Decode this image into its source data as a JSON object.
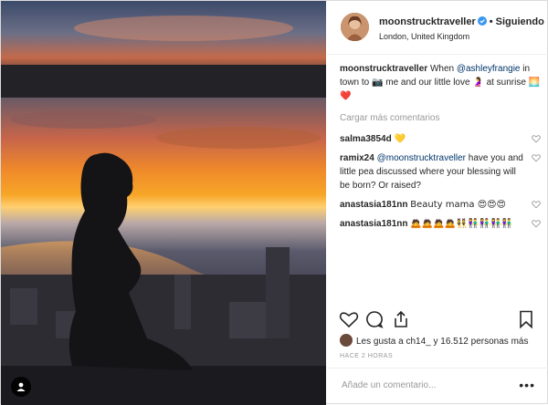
{
  "header": {
    "username": "moonstrucktraveller",
    "separator": "•",
    "follow_label": "Siguiendo",
    "location": "London, United Kingdom"
  },
  "caption": {
    "username": "moonstrucktraveller",
    "text_1": "When",
    "mention": "@ashleyfrangie",
    "text_2": "in town to",
    "emoji_1": "📷",
    "text_3": "me and our little love",
    "emoji_2": "🤰",
    "text_4": "at sunrise",
    "emoji_3": "🌅❤️"
  },
  "load_more_label": "Cargar más comentarios",
  "comments": [
    {
      "username": "salma3854d",
      "text": "💛"
    },
    {
      "username": "ramix24",
      "mention": "@moonstrucktraveller",
      "text": "have you and little pea discussed where your blessing will be born? Or raised?"
    },
    {
      "username": "anastasia181nn",
      "text": "Beauty mama 😍😍😍"
    },
    {
      "username": "anastasia181nn",
      "text": "🙇🙇🙇🙇👯👫👫👫👫"
    }
  ],
  "likes": {
    "text": "Les gusta a ch14_ y 16.512 personas más"
  },
  "timestamp": "HACE 2 HORAS",
  "add_comment": {
    "placeholder": "Añade un comentario..."
  },
  "more_options": "•••",
  "colors": {
    "border": "#dbdbdb",
    "text": "#262626",
    "muted": "#999999",
    "link": "#003569",
    "verified": "#3897f0",
    "heart": "#ed4956"
  }
}
